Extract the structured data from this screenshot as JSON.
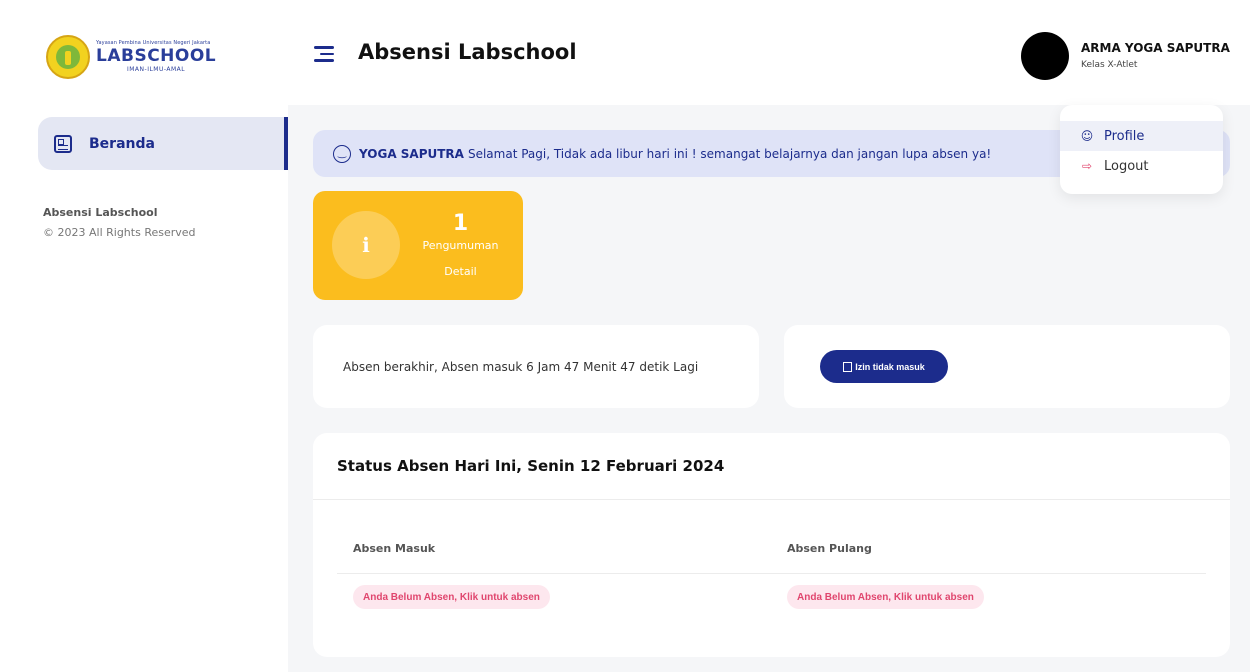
{
  "app": {
    "logo_top": "Yayasan Pembina Universitas Negeri Jakarta",
    "logo_main": "LABSCHOOL",
    "logo_sub": "IMAN-ILMU-AMAL"
  },
  "sidebar": {
    "items": [
      {
        "label": "Beranda",
        "icon": "dashboard-icon",
        "active": true
      }
    ],
    "footer_title": "Absensi Labschool",
    "footer_copy": "© 2023 All Rights Reserved"
  },
  "header": {
    "title": "Absensi Labschool",
    "user_name": "ARMA YOGA SAPUTRA",
    "user_class": "Kelas X-Atlet"
  },
  "dropdown": {
    "items": [
      {
        "label": "Profile",
        "icon": "user-icon"
      },
      {
        "label": "Logout",
        "icon": "logout-icon"
      }
    ]
  },
  "alert": {
    "name": "YOGA SAPUTRA",
    "message": "Selamat Pagi, Tidak ada libur hari ini ! semangat belajarnya dan jangan lupa absen ya!"
  },
  "announcement": {
    "count": "1",
    "label": "Pengumuman",
    "link": "Detail"
  },
  "timer": {
    "text": "Absen berakhir, Absen masuk 6 Jam 47 Menit 47 detik Lagi"
  },
  "izin": {
    "button_label": "Izin tidak masuk"
  },
  "status": {
    "title": "Status Absen Hari Ini, Senin 12 Februari 2024",
    "columns": [
      "Absen Masuk",
      "Absen Pulang"
    ],
    "values": [
      "Anda Belum Absen, Klik untuk absen",
      "Anda Belum Absen, Klik untuk absen"
    ]
  },
  "colors": {
    "primary": "#1c2c8c",
    "accent": "#fbbd1e",
    "danger": "#e0466e",
    "alert_bg": "#dfe3f7"
  }
}
